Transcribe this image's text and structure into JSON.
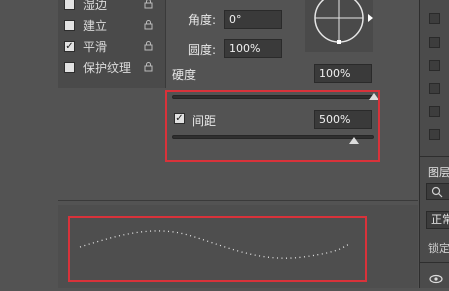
{
  "options": [
    {
      "label": "湿边",
      "checked": false
    },
    {
      "label": "建立",
      "checked": false
    },
    {
      "label": "平滑",
      "checked": true
    },
    {
      "label": "保护纹理",
      "checked": false
    }
  ],
  "angle": {
    "label": "角度:",
    "value": "0°"
  },
  "roundness": {
    "label": "圆度:",
    "value": "100%"
  },
  "hardness": {
    "label": "硬度",
    "value": "100%",
    "slider_fraction": 1.0
  },
  "spacing": {
    "label": "间距",
    "value": "500%",
    "checked": true,
    "slider_fraction": 0.9
  },
  "right_panel": {
    "layers_tab": "图层",
    "normal_btn": "正常",
    "lock_label": "锁定"
  },
  "icons": {
    "checkmark": "✓",
    "lock": "lock-icon",
    "arrow": "triangle-right-icon",
    "search": "search-icon",
    "eye": "eye-icon"
  },
  "colors": {
    "highlight": "#d9323a",
    "panel": "#535353"
  }
}
